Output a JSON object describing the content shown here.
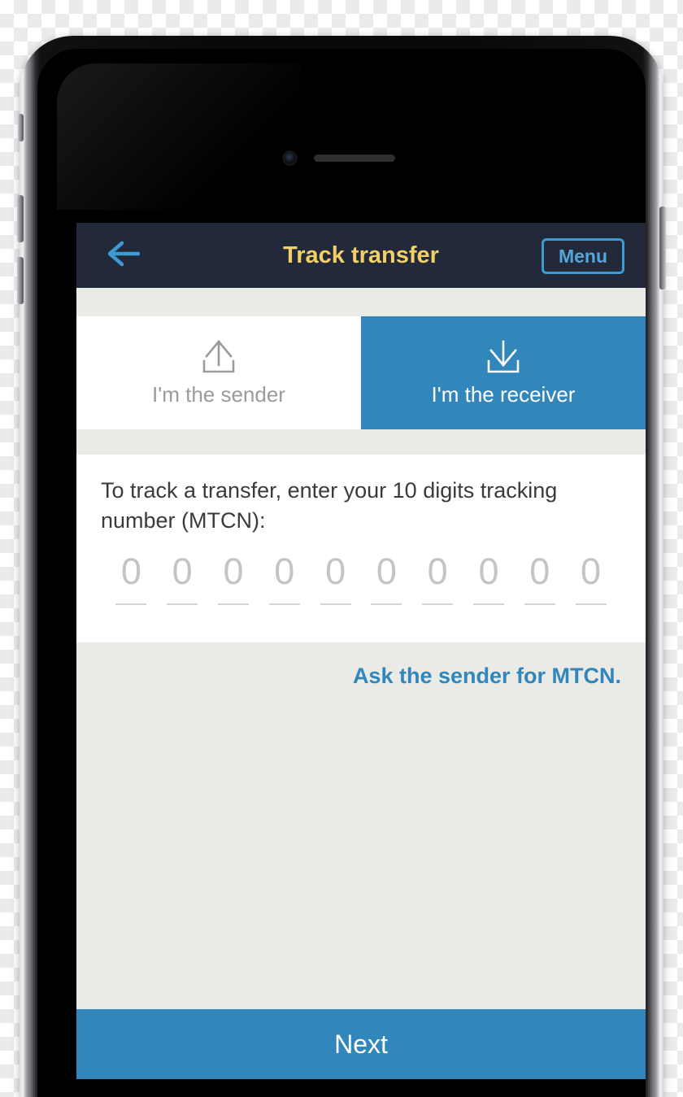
{
  "header": {
    "title": "Track transfer",
    "back_icon": "arrow-left-icon",
    "menu_label": "Menu",
    "bg_color": "#22293a",
    "title_color": "#f2d066",
    "accent_color": "#3d9bd4"
  },
  "tabs": [
    {
      "label": "I'm the sender",
      "icon": "upload-icon",
      "active": false
    },
    {
      "label": "I'm the receiver",
      "icon": "download-icon",
      "active": true
    }
  ],
  "mtcn": {
    "instruction": "To track a transfer, enter your 10 digits tracking number (MTCN):",
    "digits": [
      "0",
      "0",
      "0",
      "0",
      "0",
      "0",
      "0",
      "0",
      "0",
      "0"
    ],
    "digit_count": 10,
    "placeholder_color": "#c3c4c6"
  },
  "body": {
    "ask_sender_link": "Ask the sender for MTCN.",
    "link_color": "#3187bb",
    "bg_color": "#eaeae6"
  },
  "footer": {
    "next_label": "Next",
    "next_bg_color": "#3187bb"
  }
}
